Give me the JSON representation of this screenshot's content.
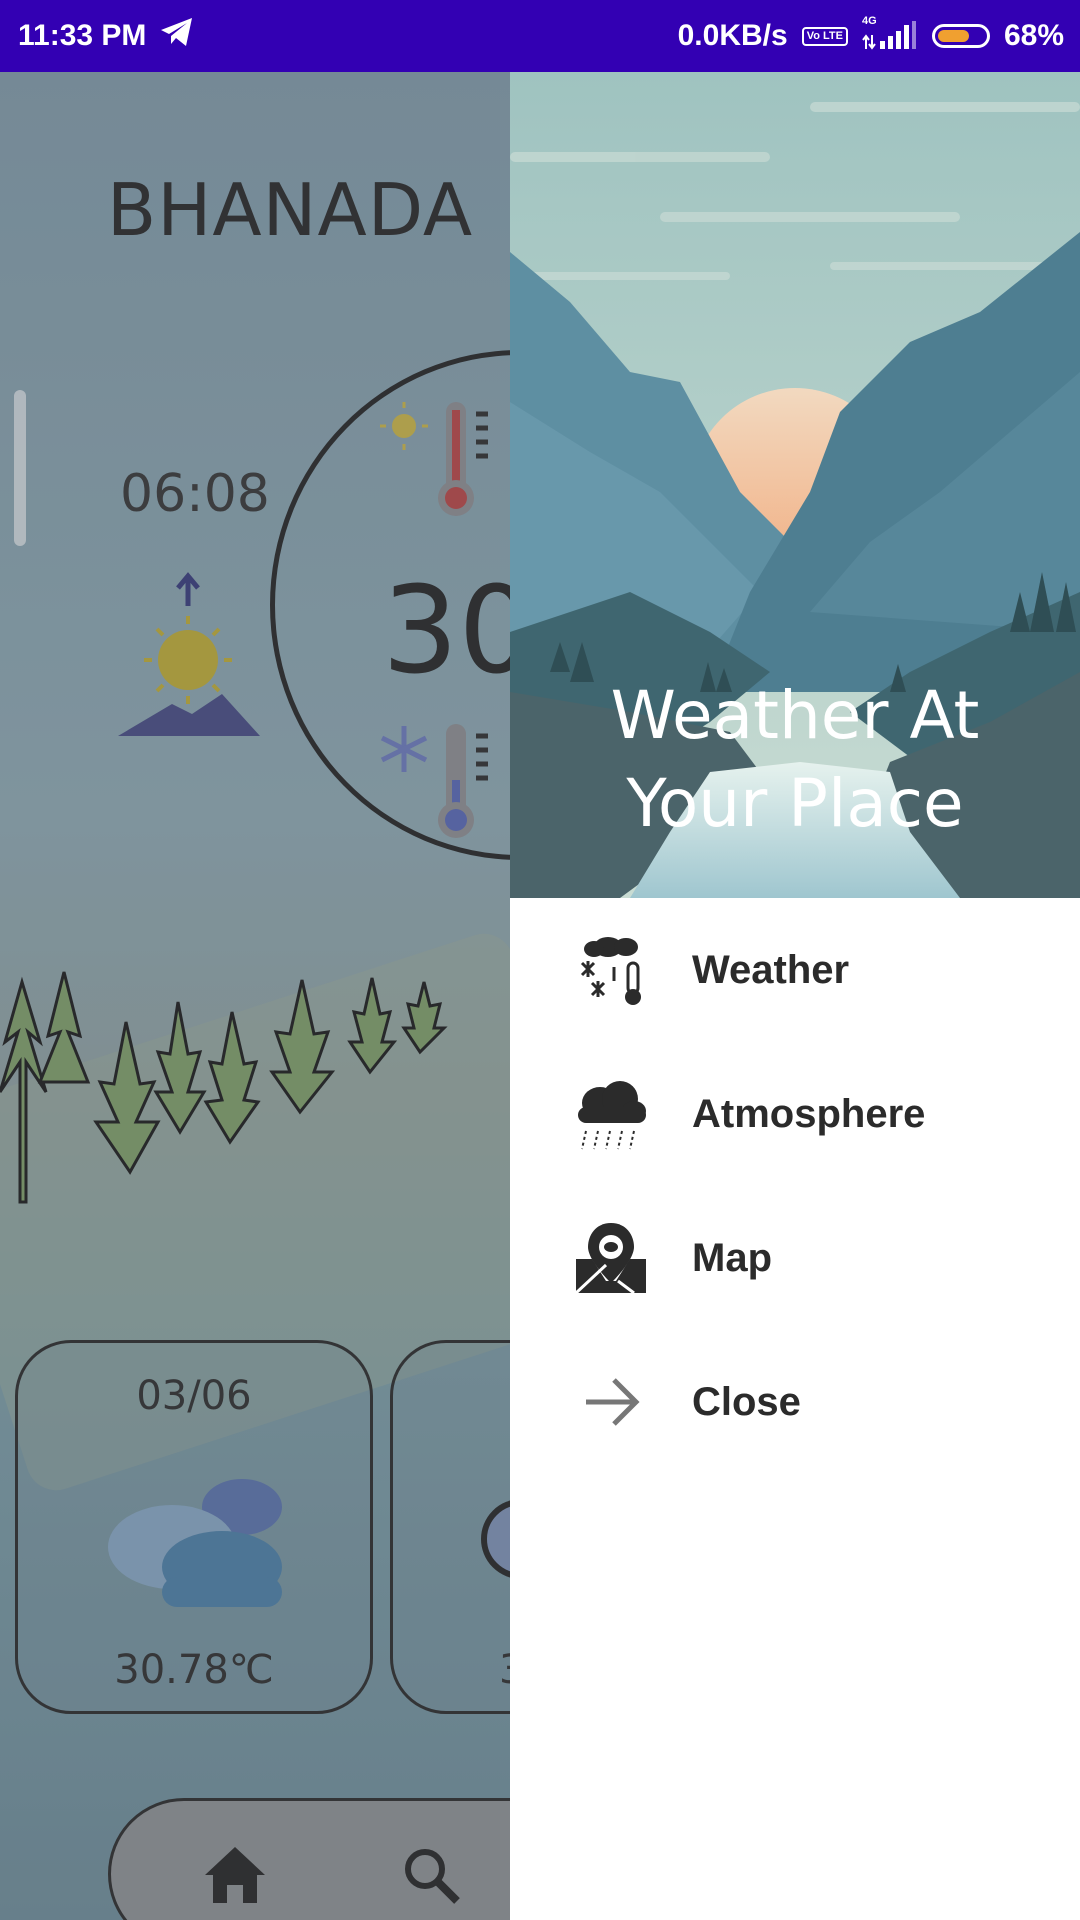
{
  "status_bar": {
    "time": "11:33 PM",
    "net_speed": "0.0KB/s",
    "volte_badge": "Vo LTE",
    "network_type": "4G",
    "battery_percent": "68%",
    "battery_level": 0.68
  },
  "background_app": {
    "city": "BHANADA",
    "sunrise_time": "06:08",
    "current_temp_partial": "30",
    "forecast_cards": [
      {
        "date": "03/06",
        "temp": "30.78℃",
        "icon": "cloudy-icon"
      },
      {
        "date": "",
        "temp": "3",
        "icon": "partial-icon"
      }
    ],
    "bottom_nav": [
      "home-icon",
      "search-icon"
    ]
  },
  "drawer": {
    "header_title_line1": "Weather At",
    "header_title_line2": "Your Place",
    "menu": [
      {
        "label": "Weather",
        "icon": "weather-icon"
      },
      {
        "label": "Atmosphere",
        "icon": "rain-cloud-icon"
      },
      {
        "label": "Map",
        "icon": "map-pin-icon"
      },
      {
        "label": "Close",
        "icon": "arrow-right-icon"
      }
    ]
  },
  "colors": {
    "status_bar": "#3300b3",
    "drawer_bg": "#ffffff",
    "menu_text": "#2b2b2b"
  }
}
